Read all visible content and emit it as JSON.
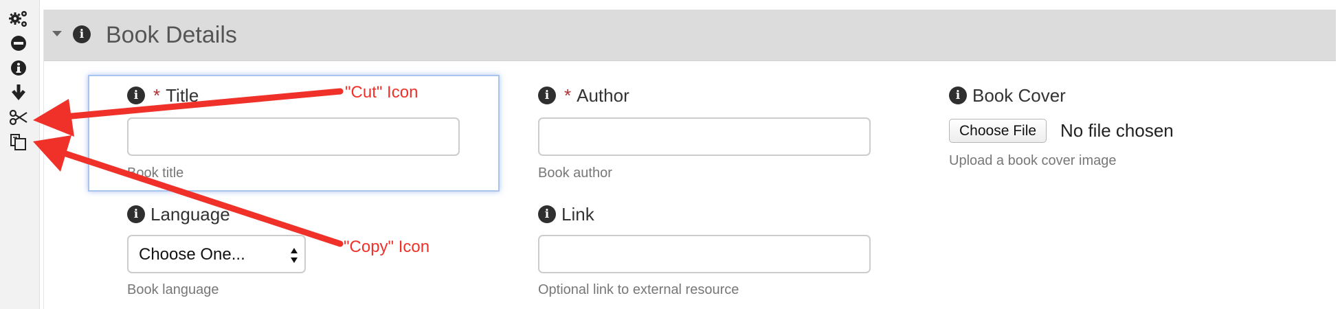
{
  "toolbar": {
    "icons": [
      "settings-icon",
      "remove-icon",
      "info-icon",
      "move-down-icon",
      "cut-icon",
      "copy-icon"
    ]
  },
  "panel": {
    "title": "Book Details",
    "info_glyph": "i"
  },
  "fields": {
    "title": {
      "required_mark": "*",
      "label": "Title",
      "value": "",
      "help": "Book title"
    },
    "author": {
      "required_mark": "*",
      "label": "Author",
      "value": "",
      "help": "Book author"
    },
    "book_cover": {
      "label": "Book Cover",
      "button_label": "Choose File",
      "status": "No file chosen",
      "help": "Upload a book cover image"
    },
    "language": {
      "label": "Language",
      "selected": "Choose One...",
      "help": "Book language"
    },
    "link": {
      "label": "Link",
      "value": "",
      "help": "Optional link to external resource"
    }
  },
  "annotations": {
    "cut_label": "\"Cut\" Icon",
    "copy_label": "\"Copy\" Icon",
    "color": "#f0312a"
  },
  "colors": {
    "header_bg": "#dcdcdc",
    "required": "#b03030",
    "focus_border": "#a9c4ee"
  }
}
